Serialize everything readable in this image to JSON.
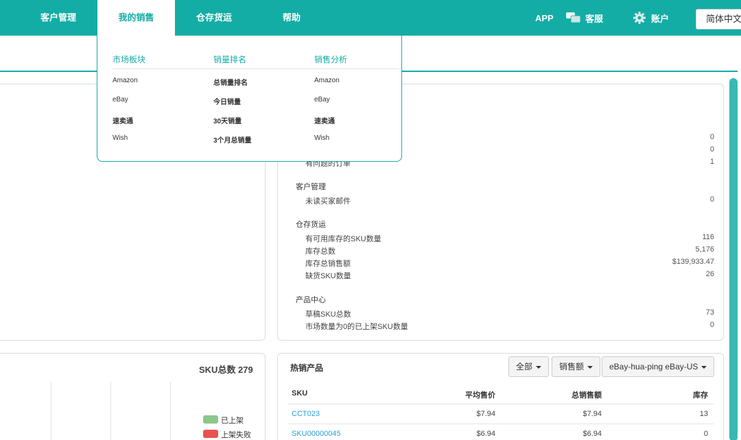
{
  "nav": {
    "items": [
      {
        "label": "客户管理"
      },
      {
        "label": "我的销售"
      },
      {
        "label": "仓存货运"
      },
      {
        "label": "帮助"
      }
    ],
    "app": "APP",
    "service": "客服",
    "account": "账户",
    "language": "简体中文"
  },
  "megamenu": {
    "columns": [
      {
        "title": "市场板块",
        "items": [
          "Amazon",
          "eBay",
          "速卖通",
          "Wish"
        ]
      },
      {
        "title": "销量排名",
        "items": [
          "总销量排名",
          "今日销量",
          "30天销量",
          "3个月总销量"
        ]
      },
      {
        "title": "销售分析",
        "items": [
          "Amazon",
          "eBay",
          "速卖通",
          "Wish"
        ]
      }
    ]
  },
  "summary": {
    "orders_partial_label": "有问题的订单",
    "orders_values": [
      "0",
      "0",
      "1"
    ],
    "sections": [
      {
        "title": "客户管理",
        "rows": [
          {
            "label": "未读买家邮件",
            "value": "0"
          }
        ]
      },
      {
        "title": "仓存货运",
        "rows": [
          {
            "label": "有可用库存的SKU数量",
            "value": "116"
          },
          {
            "label": "库存总数",
            "value": "5,176"
          },
          {
            "label": "库存总销售额",
            "value": "$139,933.47"
          },
          {
            "label": "缺货SKU数量",
            "value": "26"
          }
        ]
      },
      {
        "title": "产品中心",
        "rows": [
          {
            "label": "草稿SKU总数",
            "value": "73"
          },
          {
            "label": "市场数量为0的已上架SKU数量",
            "value": "0"
          }
        ]
      }
    ]
  },
  "sku_chart": {
    "title": "SKU总数 279",
    "legend": [
      {
        "label": "已上架",
        "color": "#8cc78c"
      },
      {
        "label": "上架失败",
        "color": "#e8534e"
      }
    ]
  },
  "hot_products": {
    "title": "热销产品",
    "filters": {
      "scope": "全部",
      "metric": "销售额",
      "account": "eBay-hua-ping eBay-US"
    },
    "columns": [
      "SKU",
      "平均售价",
      "总销售额",
      "库存"
    ],
    "rows": [
      {
        "sku": "CCT023",
        "avg_price": "$7.94",
        "total": "$7.94",
        "stock": "13"
      },
      {
        "sku": "SKU00000045",
        "avg_price": "$6.94",
        "total": "$6.94",
        "stock": "0"
      }
    ]
  },
  "colors": {
    "brand": "#14ada5",
    "link": "#2a9fd6"
  }
}
